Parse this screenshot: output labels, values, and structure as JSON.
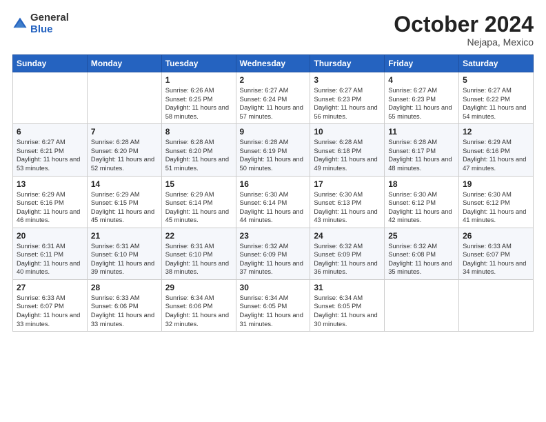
{
  "header": {
    "logo_general": "General",
    "logo_blue": "Blue",
    "month": "October 2024",
    "location": "Nejapa, Mexico"
  },
  "weekdays": [
    "Sunday",
    "Monday",
    "Tuesday",
    "Wednesday",
    "Thursday",
    "Friday",
    "Saturday"
  ],
  "weeks": [
    [
      {
        "day": "",
        "sunrise": "",
        "sunset": "",
        "daylight": ""
      },
      {
        "day": "",
        "sunrise": "",
        "sunset": "",
        "daylight": ""
      },
      {
        "day": "1",
        "sunrise": "Sunrise: 6:26 AM",
        "sunset": "Sunset: 6:25 PM",
        "daylight": "Daylight: 11 hours and 58 minutes."
      },
      {
        "day": "2",
        "sunrise": "Sunrise: 6:27 AM",
        "sunset": "Sunset: 6:24 PM",
        "daylight": "Daylight: 11 hours and 57 minutes."
      },
      {
        "day": "3",
        "sunrise": "Sunrise: 6:27 AM",
        "sunset": "Sunset: 6:23 PM",
        "daylight": "Daylight: 11 hours and 56 minutes."
      },
      {
        "day": "4",
        "sunrise": "Sunrise: 6:27 AM",
        "sunset": "Sunset: 6:23 PM",
        "daylight": "Daylight: 11 hours and 55 minutes."
      },
      {
        "day": "5",
        "sunrise": "Sunrise: 6:27 AM",
        "sunset": "Sunset: 6:22 PM",
        "daylight": "Daylight: 11 hours and 54 minutes."
      }
    ],
    [
      {
        "day": "6",
        "sunrise": "Sunrise: 6:27 AM",
        "sunset": "Sunset: 6:21 PM",
        "daylight": "Daylight: 11 hours and 53 minutes."
      },
      {
        "day": "7",
        "sunrise": "Sunrise: 6:28 AM",
        "sunset": "Sunset: 6:20 PM",
        "daylight": "Daylight: 11 hours and 52 minutes."
      },
      {
        "day": "8",
        "sunrise": "Sunrise: 6:28 AM",
        "sunset": "Sunset: 6:20 PM",
        "daylight": "Daylight: 11 hours and 51 minutes."
      },
      {
        "day": "9",
        "sunrise": "Sunrise: 6:28 AM",
        "sunset": "Sunset: 6:19 PM",
        "daylight": "Daylight: 11 hours and 50 minutes."
      },
      {
        "day": "10",
        "sunrise": "Sunrise: 6:28 AM",
        "sunset": "Sunset: 6:18 PM",
        "daylight": "Daylight: 11 hours and 49 minutes."
      },
      {
        "day": "11",
        "sunrise": "Sunrise: 6:28 AM",
        "sunset": "Sunset: 6:17 PM",
        "daylight": "Daylight: 11 hours and 48 minutes."
      },
      {
        "day": "12",
        "sunrise": "Sunrise: 6:29 AM",
        "sunset": "Sunset: 6:16 PM",
        "daylight": "Daylight: 11 hours and 47 minutes."
      }
    ],
    [
      {
        "day": "13",
        "sunrise": "Sunrise: 6:29 AM",
        "sunset": "Sunset: 6:16 PM",
        "daylight": "Daylight: 11 hours and 46 minutes."
      },
      {
        "day": "14",
        "sunrise": "Sunrise: 6:29 AM",
        "sunset": "Sunset: 6:15 PM",
        "daylight": "Daylight: 11 hours and 45 minutes."
      },
      {
        "day": "15",
        "sunrise": "Sunrise: 6:29 AM",
        "sunset": "Sunset: 6:14 PM",
        "daylight": "Daylight: 11 hours and 45 minutes."
      },
      {
        "day": "16",
        "sunrise": "Sunrise: 6:30 AM",
        "sunset": "Sunset: 6:14 PM",
        "daylight": "Daylight: 11 hours and 44 minutes."
      },
      {
        "day": "17",
        "sunrise": "Sunrise: 6:30 AM",
        "sunset": "Sunset: 6:13 PM",
        "daylight": "Daylight: 11 hours and 43 minutes."
      },
      {
        "day": "18",
        "sunrise": "Sunrise: 6:30 AM",
        "sunset": "Sunset: 6:12 PM",
        "daylight": "Daylight: 11 hours and 42 minutes."
      },
      {
        "day": "19",
        "sunrise": "Sunrise: 6:30 AM",
        "sunset": "Sunset: 6:12 PM",
        "daylight": "Daylight: 11 hours and 41 minutes."
      }
    ],
    [
      {
        "day": "20",
        "sunrise": "Sunrise: 6:31 AM",
        "sunset": "Sunset: 6:11 PM",
        "daylight": "Daylight: 11 hours and 40 minutes."
      },
      {
        "day": "21",
        "sunrise": "Sunrise: 6:31 AM",
        "sunset": "Sunset: 6:10 PM",
        "daylight": "Daylight: 11 hours and 39 minutes."
      },
      {
        "day": "22",
        "sunrise": "Sunrise: 6:31 AM",
        "sunset": "Sunset: 6:10 PM",
        "daylight": "Daylight: 11 hours and 38 minutes."
      },
      {
        "day": "23",
        "sunrise": "Sunrise: 6:32 AM",
        "sunset": "Sunset: 6:09 PM",
        "daylight": "Daylight: 11 hours and 37 minutes."
      },
      {
        "day": "24",
        "sunrise": "Sunrise: 6:32 AM",
        "sunset": "Sunset: 6:09 PM",
        "daylight": "Daylight: 11 hours and 36 minutes."
      },
      {
        "day": "25",
        "sunrise": "Sunrise: 6:32 AM",
        "sunset": "Sunset: 6:08 PM",
        "daylight": "Daylight: 11 hours and 35 minutes."
      },
      {
        "day": "26",
        "sunrise": "Sunrise: 6:33 AM",
        "sunset": "Sunset: 6:07 PM",
        "daylight": "Daylight: 11 hours and 34 minutes."
      }
    ],
    [
      {
        "day": "27",
        "sunrise": "Sunrise: 6:33 AM",
        "sunset": "Sunset: 6:07 PM",
        "daylight": "Daylight: 11 hours and 33 minutes."
      },
      {
        "day": "28",
        "sunrise": "Sunrise: 6:33 AM",
        "sunset": "Sunset: 6:06 PM",
        "daylight": "Daylight: 11 hours and 33 minutes."
      },
      {
        "day": "29",
        "sunrise": "Sunrise: 6:34 AM",
        "sunset": "Sunset: 6:06 PM",
        "daylight": "Daylight: 11 hours and 32 minutes."
      },
      {
        "day": "30",
        "sunrise": "Sunrise: 6:34 AM",
        "sunset": "Sunset: 6:05 PM",
        "daylight": "Daylight: 11 hours and 31 minutes."
      },
      {
        "day": "31",
        "sunrise": "Sunrise: 6:34 AM",
        "sunset": "Sunset: 6:05 PM",
        "daylight": "Daylight: 11 hours and 30 minutes."
      },
      {
        "day": "",
        "sunrise": "",
        "sunset": "",
        "daylight": ""
      },
      {
        "day": "",
        "sunrise": "",
        "sunset": "",
        "daylight": ""
      }
    ]
  ]
}
